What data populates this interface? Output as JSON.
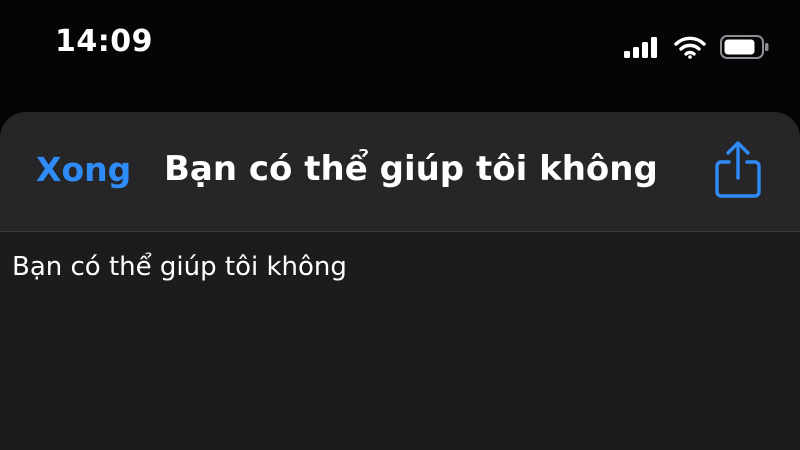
{
  "status_bar": {
    "time": "14:09",
    "icons": [
      "cellular-signal-icon",
      "wifi-icon",
      "battery-icon"
    ]
  },
  "nav_bar": {
    "done_label": "Xong",
    "title": "Bạn có thể giúp tôi không",
    "share_icon": "share-icon"
  },
  "content": {
    "text": "Bạn có thể giúp tôi không"
  },
  "colors": {
    "accent": "#2f8bf6",
    "sheet_background": "#1c1c1e",
    "nav_background": "#262628",
    "screen_background": "#050507"
  }
}
